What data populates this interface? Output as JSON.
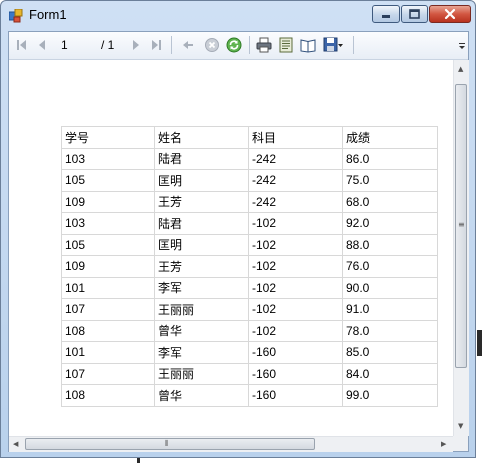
{
  "window": {
    "title": "Form1"
  },
  "toolbar": {
    "current_page": "1",
    "total_pages": "/ 1",
    "icons": [
      "first-page-icon",
      "previous-page-icon",
      "next-page-icon",
      "last-page-icon",
      "back-icon",
      "stop-icon",
      "refresh-icon",
      "print-icon",
      "print-layout-icon",
      "page-setup-icon",
      "export-icon"
    ]
  },
  "report": {
    "headers": [
      "学号",
      "姓名",
      "科目",
      "成绩"
    ],
    "rows": [
      [
        "103",
        "陆君",
        "-242",
        "86.0"
      ],
      [
        "105",
        "匡明",
        "-242",
        "75.0"
      ],
      [
        "109",
        "王芳",
        "-242",
        "68.0"
      ],
      [
        "103",
        "陆君",
        "-102",
        "92.0"
      ],
      [
        "105",
        "匡明",
        "-102",
        "88.0"
      ],
      [
        "109",
        "王芳",
        "-102",
        "76.0"
      ],
      [
        "101",
        "李军",
        "-102",
        "90.0"
      ],
      [
        "107",
        "王丽丽",
        "-102",
        "91.0"
      ],
      [
        "108",
        "曾华",
        "-102",
        "78.0"
      ],
      [
        "101",
        "李军",
        "-160",
        "85.0"
      ],
      [
        "107",
        "王丽丽",
        "-160",
        "84.0"
      ],
      [
        "108",
        "曾华",
        "-160",
        "99.0"
      ]
    ]
  },
  "colors": {
    "titlebar": "#c4d8ef",
    "close_button": "#c7432d",
    "grid_line": "#d8d8d8"
  }
}
